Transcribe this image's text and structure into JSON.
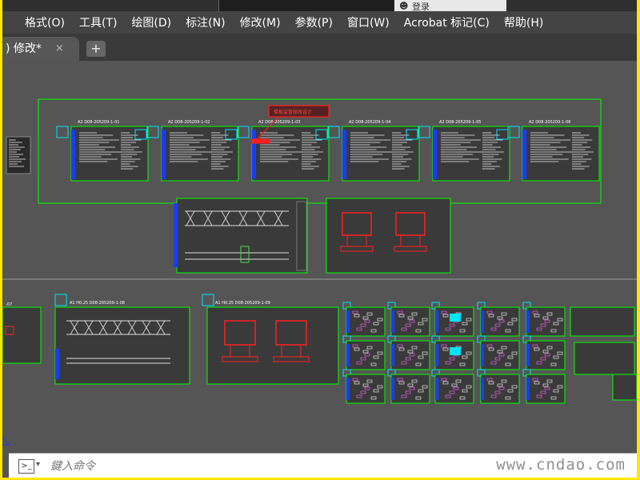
{
  "search": {
    "value": "登录"
  },
  "menu": [
    "格式(O)",
    "工具(T)",
    "绘图(D)",
    "标注(N)",
    "修改(M)",
    "参数(P)",
    "窗口(W)",
    "Acrobat 标记(C)",
    "帮助(H)"
  ],
  "tab": {
    "label": ") 修改*",
    "close": "×",
    "new": "+"
  },
  "drawing": {
    "sheet_titles": [
      "A2 D08-205209-1-01",
      "A2 D08-205209-1-02",
      "A2 D08-205209-1-03",
      "A2 D08-205209-1-04",
      "A2 D08-205209-1-05",
      "A2 D08-205209-1-06"
    ],
    "lower_titles": [
      "-07",
      "A1 H0.25 D08-205209-1-08",
      "A1 H0.25 D08-205209-1-09"
    ],
    "callout": "楼板监督修改设计"
  },
  "command": {
    "placeholder": "鍵入命令",
    "prompt_icon": ">_"
  },
  "watermark": "www.cndao.com",
  "colors": {
    "frame": "#ffe600",
    "canvas": "#555555",
    "sheet_border": "#00ff00",
    "highlight": "#ff2020",
    "cyan": "#00e5ff",
    "blue": "#1a3cff"
  }
}
